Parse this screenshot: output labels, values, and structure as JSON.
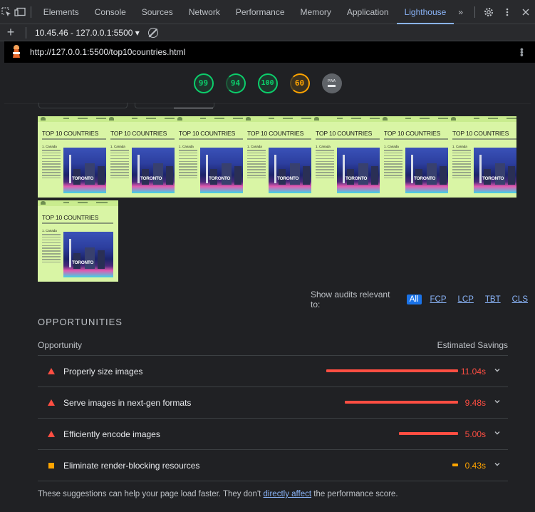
{
  "devtools": {
    "tabs": [
      "Elements",
      "Console",
      "Sources",
      "Network",
      "Performance",
      "Memory",
      "Application",
      "Lighthouse"
    ],
    "active_tab": "Lighthouse",
    "more": "»"
  },
  "lighthouse_toolbar": {
    "add": "+",
    "report_selector": "10.45.46 - 127.0.0.1:5500 ▾"
  },
  "url_bar": {
    "url": "http://127.0.0.1:5500/top10countries.html"
  },
  "scores": {
    "performance": "99",
    "accessibility": "94",
    "best_practices": "100",
    "seo": "60",
    "pwa_label": "PWA"
  },
  "filmstrip": {
    "title": "TOP 10 COUNTRIES",
    "heading": "1. Canada",
    "image_text": "TORONTO"
  },
  "filter": {
    "label": "Show audits relevant to:",
    "options": [
      "All",
      "FCP",
      "LCP",
      "TBT",
      "CLS"
    ],
    "selected": "All"
  },
  "opportunities": {
    "section_title": "OPPORTUNITIES",
    "col_opportunity": "Opportunity",
    "col_savings": "Estimated Savings",
    "items": [
      {
        "label": "Properly size images",
        "savings": "11.04s",
        "severity": "fail",
        "fraction": 1.0
      },
      {
        "label": "Serve images in next-gen formats",
        "savings": "9.48s",
        "severity": "fail",
        "fraction": 0.86
      },
      {
        "label": "Efficiently encode images",
        "savings": "5.00s",
        "severity": "fail",
        "fraction": 0.45
      },
      {
        "label": "Eliminate render-blocking resources",
        "savings": "0.43s",
        "severity": "average",
        "fraction": 0.04
      }
    ]
  },
  "footnote": {
    "before": "These suggestions can help your page load faster. They don't ",
    "link": "directly affect",
    "after": " the performance score."
  },
  "colors": {
    "pass": "#0cce6b",
    "average": "#ffa400",
    "fail": "#ff4e42",
    "accent": "#8ab4f8"
  }
}
